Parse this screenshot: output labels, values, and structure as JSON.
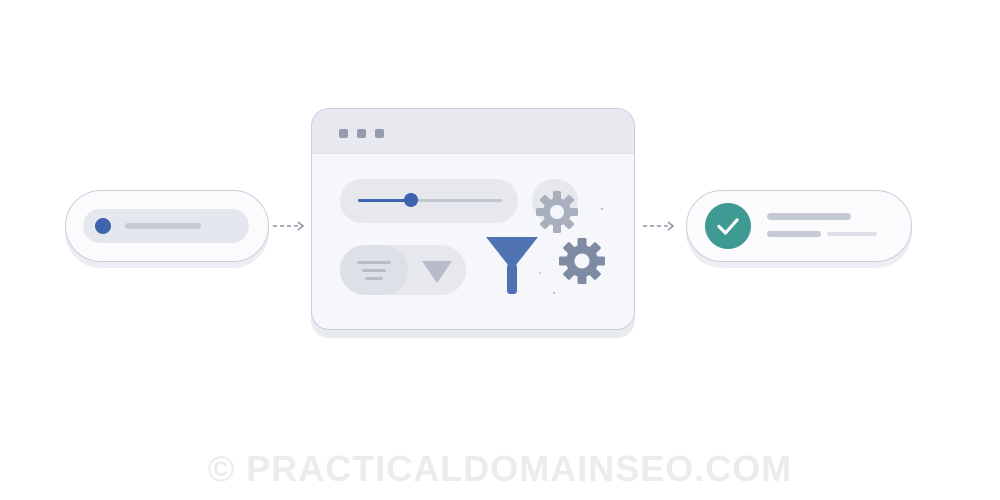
{
  "watermark": {
    "text": "© PRACTICALDOMAINSEO.COM"
  },
  "flow": {
    "input": {
      "icon": "dot-icon",
      "accent": "#3f64ad"
    },
    "processor": {
      "window_controls": [
        "dot",
        "dot",
        "dot"
      ],
      "slider": {
        "value_fraction": 0.37,
        "color": "#3f64ad"
      },
      "icons": [
        "gear-icon",
        "funnel-icon",
        "gear-icon",
        "align-lines-icon",
        "triangle-icon"
      ]
    },
    "output": {
      "icon": "checkmark-icon",
      "accent": "#3f9a93"
    }
  }
}
